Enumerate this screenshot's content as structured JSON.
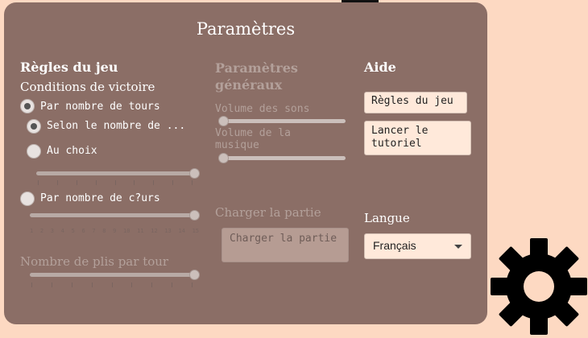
{
  "dialog": {
    "title": "Paramètres"
  },
  "rules": {
    "heading": "Règles du jeu",
    "victory_label": "Conditions de victoire",
    "opt_rounds": "Par nombre de tours",
    "opt_by_count": "Selon le nombre de ...",
    "opt_choice": "Au choix",
    "opt_hearts": "Par nombre de c?urs",
    "rounds_slider_value": 1.0,
    "hearts_slider_value": 1.0,
    "hearts_ticks": [
      "1",
      "2",
      "3",
      "4",
      "5",
      "6",
      "7",
      "8",
      "9",
      "10",
      "11",
      "12",
      "13",
      "14",
      "15"
    ],
    "tricks_label": "Nombre de plis par tour",
    "tricks_slider_value": 1.0
  },
  "general": {
    "heading": "Paramètres généraux",
    "sound_volume": "Volume des sons",
    "music_volume": "Volume de la musique",
    "sound_value": 0.0,
    "music_value": 0.0,
    "load_label": "Charger la partie",
    "load_button": "Charger la partie"
  },
  "help": {
    "heading": "Aide",
    "rules_button": "Règles du jeu",
    "tutorial_button": "Lancer le tutoriel"
  },
  "language": {
    "label": "Langue",
    "selected": "Français"
  },
  "icons": {
    "settings": "gear-icon",
    "dropdown": "chevron-down-icon"
  }
}
